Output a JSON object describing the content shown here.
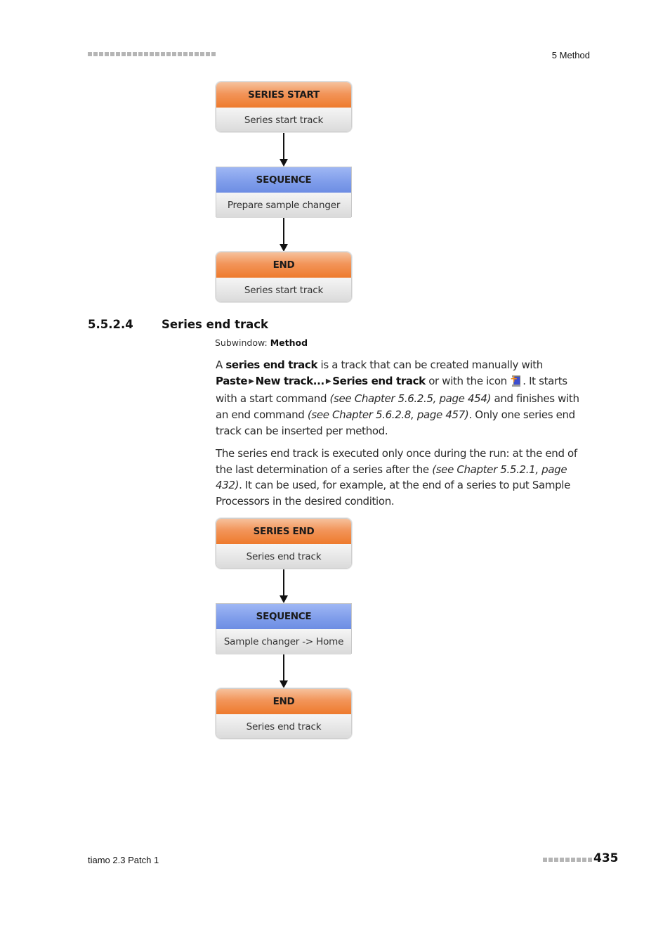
{
  "header": {
    "chapter_label": "5 Method",
    "decor_square_count": 23
  },
  "flow1": {
    "nodes": [
      {
        "title": "SERIES START",
        "label": "Series start track",
        "color": "#ee7a2c"
      },
      {
        "title": "SEQUENCE",
        "label": "Prepare sample changer",
        "color": "#7e9cea"
      },
      {
        "title": "END",
        "label": "Series start track",
        "color": "#ee7a2c"
      }
    ]
  },
  "section": {
    "number": "5.5.2.4",
    "title": "Series end track",
    "subwindow_label": "Subwindow:",
    "subwindow_value": "Method"
  },
  "paragraph1": {
    "p1": "A ",
    "b1": "series end track",
    "p2": " is a track that can be created manually with",
    "menu1": "Paste",
    "menu2": "New track...",
    "menu3": "Series end track",
    "p3": " or with the icon ",
    "icon": "series-end-track-icon",
    "p4": ". It starts with a start command ",
    "ref1": "(see Chapter 5.6.2.5, page 454)",
    "p5": " and finishes with an end command ",
    "ref2": "(see Chapter 5.6.2.8, page 457)",
    "p6": ". Only one series end track can be inserted per method."
  },
  "paragraph2": {
    "p1": "The series end track is executed only once during the run: at the end of the last determination of a series after the ",
    "ref1": "(see Chapter 5.5.2.1, page 432)",
    "p2": ". It can be used, for example, at the end of a series to put Sample Processors in the desired condition."
  },
  "flow2": {
    "nodes": [
      {
        "title": "SERIES END",
        "label": "Series end track",
        "color": "#ee7a2c"
      },
      {
        "title": "SEQUENCE",
        "label": "Sample changer -> Home",
        "color": "#7e9cea"
      },
      {
        "title": "END",
        "label": "Series end track",
        "color": "#ee7a2c"
      }
    ]
  },
  "footer": {
    "product": "tiamo 2.3 Patch 1",
    "page_number": "435",
    "decor_square_count": 9
  },
  "glyphs": {
    "menu_separator": "▶"
  }
}
